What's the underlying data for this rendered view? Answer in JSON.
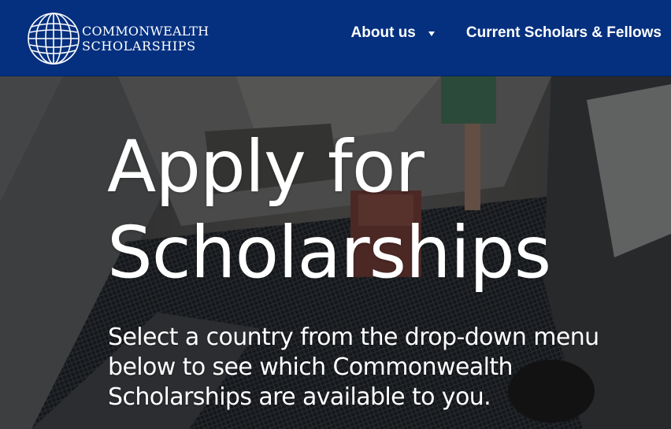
{
  "header": {
    "background_color": "#05307f",
    "logo": {
      "icon": "globe-icon",
      "line1": "COMMONWEALTH",
      "line2": "SCHOLARSHIPS"
    },
    "nav": {
      "about": {
        "label": "About us",
        "icon": "chevron-down-icon"
      },
      "current_scholars": {
        "label": "Current Scholars & Fellows"
      }
    }
  },
  "hero": {
    "title_line1": "Apply for",
    "title_line2": "Scholarships",
    "subtitle": "Select a country from the drop-down menu below to see which Commonwealth Scholarships are available to you."
  }
}
